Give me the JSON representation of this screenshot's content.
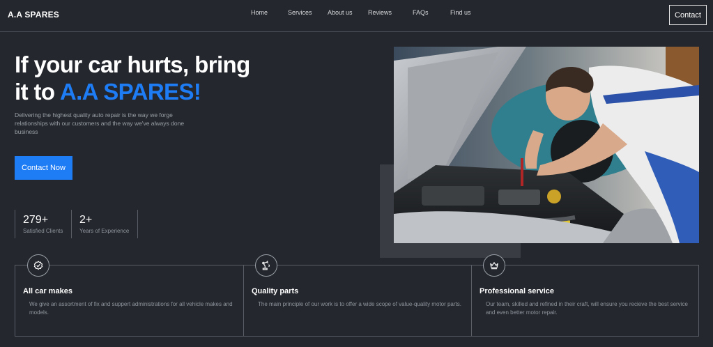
{
  "nav": {
    "brand": "A.A SPARES",
    "links": [
      "Home",
      "Services",
      "About us",
      "Reviews",
      "FAQs",
      "Find us"
    ],
    "contact_label": "Contact"
  },
  "hero": {
    "title_line1": "If your car hurts, bring",
    "title_prefix": "it to",
    "title_accent": "A.A SPARES!",
    "subtitle": "Delivering the highest quality auto repair is the way we forge relationships with our customers and the way we've always done business",
    "cta_label": "Contact Now",
    "stats": [
      {
        "value": "279+",
        "label": "Satisfied Clients"
      },
      {
        "value": "2+",
        "label": "Years of Experience"
      }
    ]
  },
  "features": [
    {
      "icon": "badge-check-icon",
      "title": "All car makes",
      "description": "We give an assortment of fix and suppert administrations for all vehicle makes and models."
    },
    {
      "icon": "robot-arm-icon",
      "title": "Quality parts",
      "description": "The main principle of our work is to offer a wide scope of value-quality motor parts."
    },
    {
      "icon": "crown-icon",
      "title": "Professional service",
      "description": "Our team, skilled and refined in their craft, will ensure you recieve the best service and even better motor repair."
    }
  ],
  "colors": {
    "background": "#24272d",
    "accent": "#1e7cf5",
    "border": "#5a5e66",
    "muted_text": "#8f959e"
  }
}
